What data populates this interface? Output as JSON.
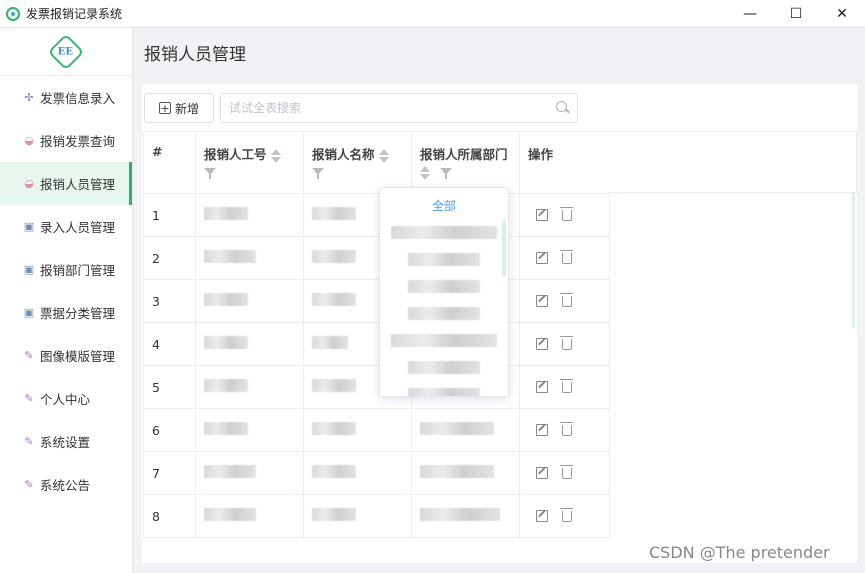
{
  "window": {
    "title": "发票报销记录系统",
    "controls": {
      "minimize": "—",
      "maximize": "☐",
      "close": "✕"
    }
  },
  "logo": {
    "text": "EE"
  },
  "sidebar": {
    "items": [
      {
        "label": "发票信息录入",
        "icon": "pinwheel-icon"
      },
      {
        "label": "报销发票查询",
        "icon": "bowl-icon"
      },
      {
        "label": "报销人员管理",
        "icon": "bowl-icon",
        "active": true
      },
      {
        "label": "录入人员管理",
        "icon": "frame-icon"
      },
      {
        "label": "报销部门管理",
        "icon": "frame-icon"
      },
      {
        "label": "票据分类管理",
        "icon": "frame-icon"
      },
      {
        "label": "图像模版管理",
        "icon": "brush-icon"
      },
      {
        "label": "个人中心",
        "icon": "brush-icon"
      },
      {
        "label": "系统设置",
        "icon": "brush-icon"
      },
      {
        "label": "系统公告",
        "icon": "brush-icon"
      }
    ]
  },
  "page": {
    "title": "报销人员管理"
  },
  "toolbar": {
    "add_label": "新增",
    "search_placeholder": "试试全表搜索"
  },
  "table": {
    "headers": {
      "idx": "#",
      "id": "报销人工号",
      "name": "报销人名称",
      "dept": "报销人所属部门",
      "op": "操作"
    },
    "rows": [
      {
        "idx": "1"
      },
      {
        "idx": "2"
      },
      {
        "idx": "3"
      },
      {
        "idx": "4"
      },
      {
        "idx": "5"
      },
      {
        "idx": "6"
      },
      {
        "idx": "7"
      },
      {
        "idx": "8"
      }
    ]
  },
  "filter_dropdown": {
    "all_label": "全部"
  },
  "watermark": "CSDN @The  pretender",
  "colors": {
    "accent": "#2fb36a",
    "link": "#409eff"
  }
}
